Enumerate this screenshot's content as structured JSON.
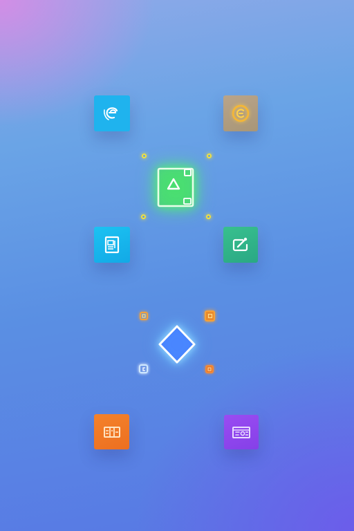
{
  "icons": {
    "top_left": "swirl-e-icon",
    "top_right": "gold-coin-icon",
    "center_top": "image-frame-icon",
    "mid_left": "document-icon",
    "mid_right": "edit-card-icon",
    "center_bottom": "diamond-icon",
    "bottom_left": "grid-panel-icon",
    "bottom_right": "video-card-icon"
  },
  "colors": {
    "blue_tile": "#1fb3ee",
    "tan_tile": "#b8a28a",
    "green_glow": "#4ff56a",
    "teal_tile": "#2fb88d",
    "orange_tile": "#f07a25",
    "purple_tile": "#9147ee",
    "dot_yellow": "#f4e23c",
    "diamond_white": "#ffffff"
  }
}
